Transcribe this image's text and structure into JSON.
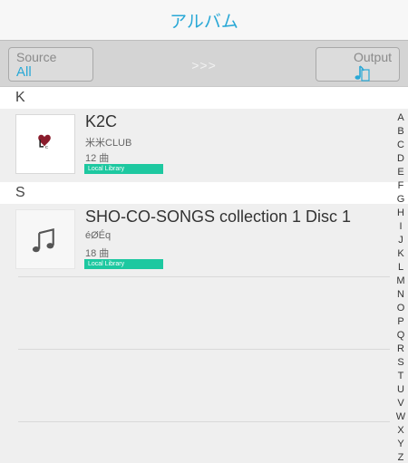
{
  "nav": {
    "title": "アルバム"
  },
  "segment": {
    "source_label": "Source",
    "source_value": "All",
    "arrows": ">>>",
    "output_label": "Output",
    "output_icon": "music-note-speaker-icon"
  },
  "sections": [
    {
      "letter": "K",
      "albums": [
        {
          "title": "K2C",
          "artist": "米米CLUB",
          "count": "12 曲",
          "badge": "Local Library",
          "artwork": "k2c-heart-logo"
        }
      ]
    },
    {
      "letter": "S",
      "albums": [
        {
          "title": "SHO-CO-SONGS collection 1 Disc 1",
          "artist": "éØÉq",
          "count": "18 曲",
          "badge": "Local Library",
          "artwork": "music-note-icon"
        }
      ]
    }
  ],
  "index_letters": [
    "A",
    "B",
    "C",
    "D",
    "E",
    "F",
    "G",
    "H",
    "I",
    "J",
    "K",
    "L",
    "M",
    "N",
    "O",
    "P",
    "Q",
    "R",
    "S",
    "T",
    "U",
    "V",
    "W",
    "X",
    "Y",
    "Z"
  ],
  "colors": {
    "accent": "#29a8d6",
    "badge": "#1dc8a0",
    "segment_bg": "#d4d4d4",
    "list_bg": "#efefef"
  }
}
